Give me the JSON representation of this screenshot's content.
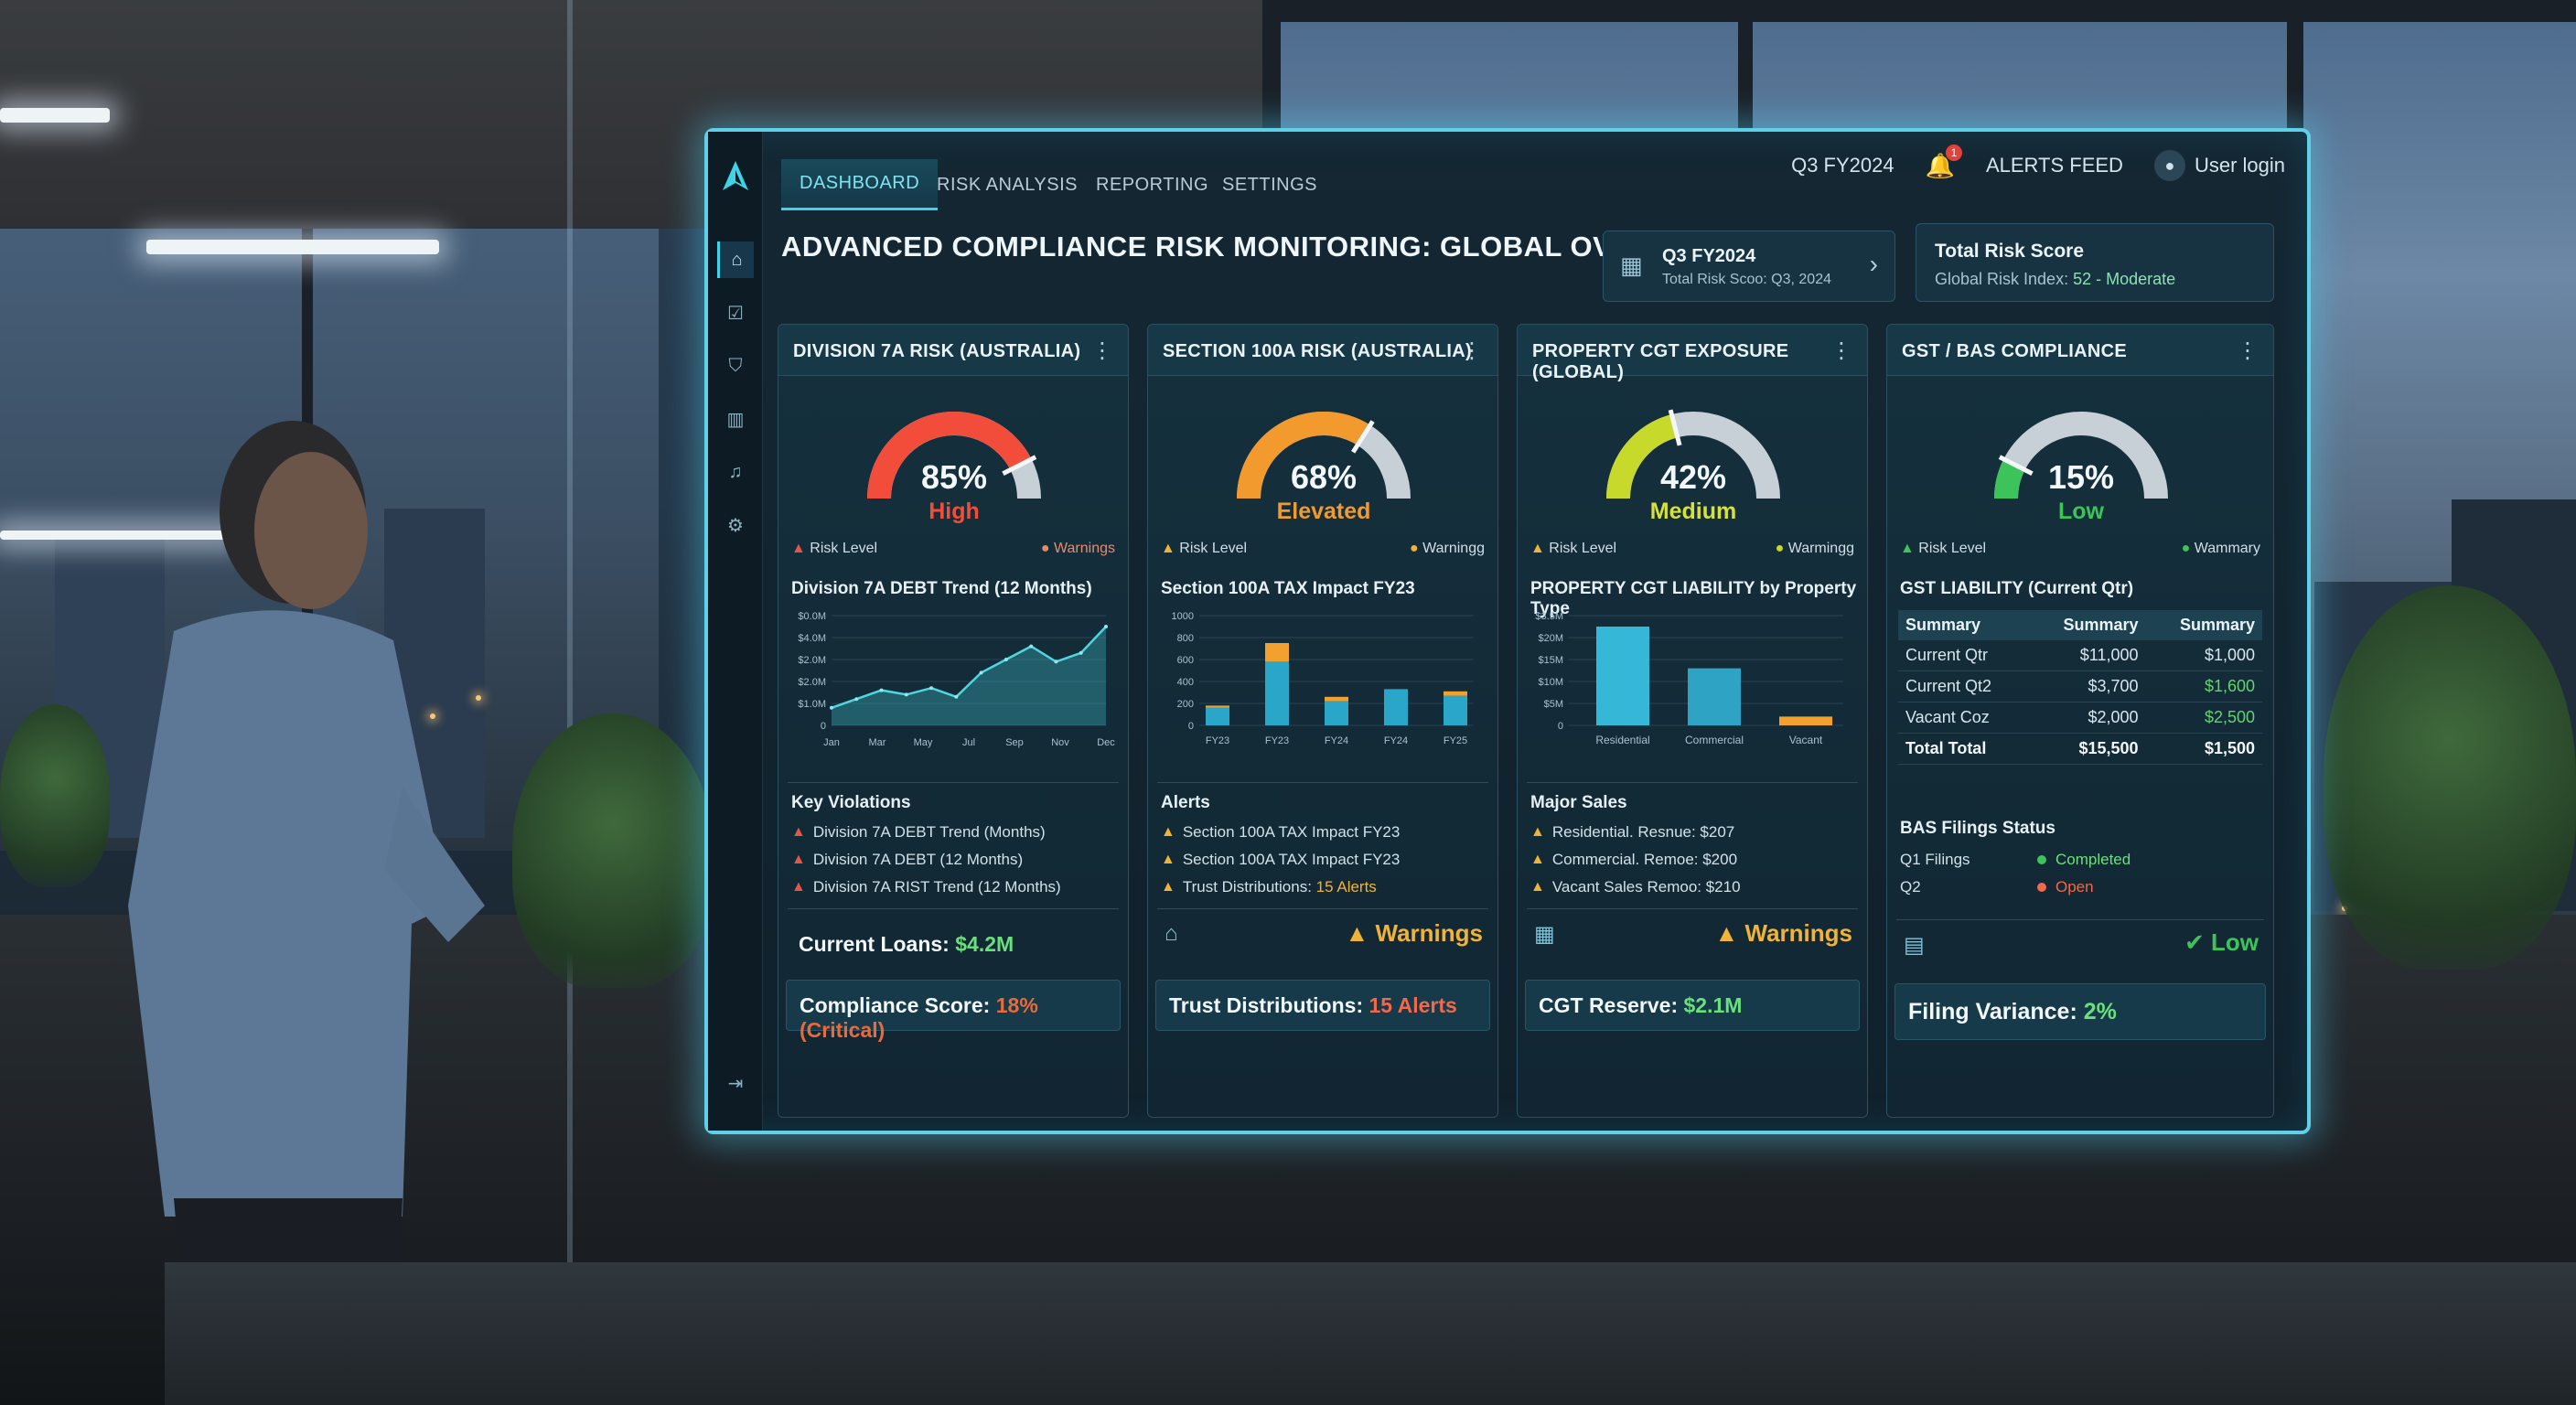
{
  "colors": {
    "accent": "#3fd3e8",
    "high": "#f24d3a",
    "elevated": "#f39a2e",
    "medium": "#c7d92a",
    "low": "#3cc45a",
    "warning": "#f0b33a",
    "critical": "#e96a3c",
    "good": "#6ae07c"
  },
  "nav": {
    "tabs": [
      "DASHBOARD",
      "RISK ANALYSIS",
      "REPORTING",
      "SETTINGS"
    ],
    "active_tab": "DASHBOARD",
    "period": "Q3 FY2024",
    "alerts_label": "ALERTS FEED",
    "alerts_count": "1",
    "user_label": "User login",
    "sidebar_icons": [
      "home-icon",
      "checklist-icon",
      "shield-icon",
      "bar-chart-icon",
      "bell-icon",
      "gear-icon",
      "logout-icon"
    ]
  },
  "header": {
    "title": "ADVANCED COMPLIANCE RISK MONITORING: GLOBAL OVERVIEW",
    "period_card": {
      "title": "Q3 FY2024",
      "subtitle": "Total Risk Scoo: Q3, 2024"
    },
    "score_card": {
      "title": "Total Risk Score",
      "prefix": "Global Risk Index:",
      "value": "52 - Moderate"
    }
  },
  "panels": [
    {
      "title": "DIVISION 7A RISK (AUSTRALIA)",
      "gauge": {
        "percent": 85,
        "value": "85%",
        "level": "High"
      },
      "risk_label": "Risk Level",
      "warn_label": "Warnings",
      "chart_title": "Division 7A DEBT Trend (12 Months)",
      "list_title": "Key Violations",
      "list": [
        "Division 7A DEBT Trend (Months)",
        "Division 7A DEBT (12 Months)",
        "Division 7A RIST Trend (12 Months)"
      ],
      "footer1": {
        "label": "Current Loans:",
        "value": "$4.2M"
      },
      "footer2": {
        "label": "Compliance Score:",
        "value": "18% (Critical)"
      }
    },
    {
      "title": "SECTION 100A RISK (AUSTRALIA)",
      "gauge": {
        "percent": 68,
        "value": "68%",
        "level": "Elevated"
      },
      "risk_label": "Risk Level",
      "warn_label": "Warningg",
      "chart_title": "Section 100A TAX Impact FY23",
      "list_title": "Alerts",
      "list": [
        "Section 100A TAX Impact FY23",
        "Section 100A TAX Impact FY23"
      ],
      "list_last": {
        "label": "Trust Distributions:",
        "value": "15 Alerts"
      },
      "warnings_big": "Warnings",
      "footer": {
        "label": "Trust Distributions:",
        "value": "15 Alerts"
      }
    },
    {
      "title": "PROPERTY CGT EXPOSURE (GLOBAL)",
      "gauge": {
        "percent": 42,
        "value": "42%",
        "level": "Medium"
      },
      "risk_label": "Risk Level",
      "warn_label": "Warmingg",
      "chart_title": "PROPERTY CGT LIABILITY by Property Type",
      "list_title": "Major Sales",
      "list": [
        "Residential. Resnue: $207",
        "Commercial. Remoe: $200",
        "Vacant Sales Remoo: $210"
      ],
      "warnings_big": "Warnings",
      "footer": {
        "label": "CGT Reserve:",
        "value": "$2.1M"
      }
    },
    {
      "title": "GST / BAS COMPLIANCE",
      "gauge": {
        "percent": 15,
        "value": "15%",
        "level": "Low"
      },
      "risk_label": "Risk Level",
      "warn_label": "Wammary",
      "table_title": "GST LIABILITY (Current Qtr)",
      "table_headers": [
        "Summary",
        "Summary",
        "Summary"
      ],
      "table_rows": [
        [
          "Current Qtr",
          "$11,000",
          "$1,000"
        ],
        [
          "Current Qt2",
          "$3,700",
          "$1,600"
        ],
        [
          "Vacant Coz",
          "$2,000",
          "$2,500"
        ]
      ],
      "table_total": [
        "Total Total",
        "$15,500",
        "$1,500"
      ],
      "bas_title": "BAS Filings Status",
      "bas": [
        {
          "label": "Q1 Filings",
          "status": "Completed",
          "color": "#3cc45a"
        },
        {
          "label": "Q2",
          "status": "Open",
          "color": "#f2684a"
        }
      ],
      "low_badge": "Low",
      "footer": {
        "label": "Filing Variance:",
        "value": "2%"
      }
    }
  ],
  "chart_data": [
    {
      "type": "area",
      "title": "Division 7A DEBT Trend (12 Months)",
      "x": [
        "Jan",
        "Feb",
        "Mar",
        "Apr",
        "May",
        "Jun",
        "Jul",
        "Aug",
        "Sep",
        "Oct",
        "Nov",
        "Dec"
      ],
      "x_tick_labels": [
        "Jan",
        "Mar",
        "May",
        "Jul",
        "Sep",
        "Nov",
        "Dec"
      ],
      "y_tick_labels": [
        "0",
        "$1.0M",
        "$2.0M",
        "$2.0M",
        "$4.0M",
        "$0.0M"
      ],
      "values": [
        0.8,
        1.2,
        1.6,
        1.4,
        1.7,
        1.3,
        2.4,
        3.0,
        3.6,
        2.9,
        3.3,
        4.5
      ],
      "ylim": [
        0,
        5
      ]
    },
    {
      "type": "bar",
      "title": "Section 100A TAX Impact FY23",
      "categories": [
        "FY23",
        "FY23",
        "FY24",
        "FY24",
        "FY25"
      ],
      "y_tick_labels": [
        "0",
        "200",
        "400",
        "600",
        "800",
        "1000"
      ],
      "series": [
        {
          "values": [
            160,
            580,
            220,
            330,
            270
          ]
        },
        {
          "values": [
            20,
            170,
            40,
            0,
            40
          ]
        }
      ],
      "ylim": [
        0,
        1000
      ]
    },
    {
      "type": "bar",
      "title": "PROPERTY CGT LIABILITY by Property Type",
      "categories": [
        "Residential",
        "Commercial",
        "Vacant"
      ],
      "y_tick_labels": [
        "0",
        "$5M",
        "$10M",
        "$15M",
        "$20M",
        "$3.5M"
      ],
      "values": [
        22.5,
        13,
        2
      ],
      "ylim": [
        0,
        25
      ]
    }
  ]
}
